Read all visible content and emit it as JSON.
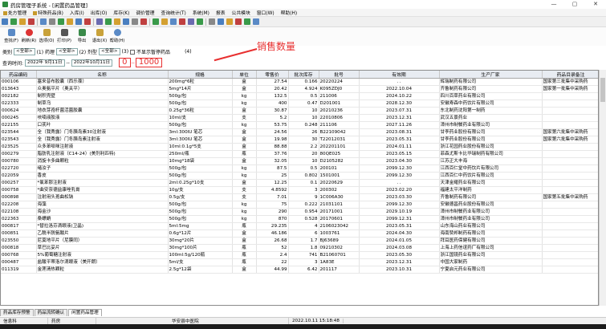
{
  "window": {
    "title": "药房管理子系统 - [闲置药品管理]",
    "controls": [
      "—",
      "▢",
      "✕"
    ]
  },
  "menubar": [
    "处方管理",
    "特殊药品(B)",
    "入库(I)",
    "出库(O)",
    "库存(K)",
    "调价管理",
    "查询统计(T)",
    "系统(M)",
    "报表",
    "公共模块",
    "窗口(W)",
    "帮助(H)"
  ],
  "actions": [
    {
      "label": "查找(F)",
      "color": "#5a8ac6"
    },
    {
      "label": "刷新(R)",
      "color": "#d33"
    },
    {
      "label": "选项(O)",
      "color": "#c9a23a"
    },
    {
      "label": "打印(P)",
      "color": "#555"
    },
    {
      "label": "导出",
      "color": "#3a8a4a"
    },
    {
      "label": "退出(X)",
      "color": "#c9a23a"
    },
    {
      "label": "帮助(H)",
      "color": "#5a8ac6"
    }
  ],
  "annotation": "销售数量",
  "filters": {
    "category_label": "类别",
    "category_value": "<全部>",
    "drug_prop_label": "(1) 药理",
    "drug_prop_value": "<全部>",
    "form_label": "(2) 剂型",
    "form_value": "<全部>",
    "form_suffix": "(3)",
    "show_disabled": "不显示暂停药品",
    "show_disabled_suffix": "(4)",
    "time_label": "查询时间:",
    "time_from": "2022年 9月11日",
    "time_sep": "--",
    "time_to": "2022年10月11日",
    "qty_from": "0",
    "qty_sep": "--",
    "qty_to": "1000"
  },
  "table": {
    "columns": [
      "药品编码",
      "名称",
      "规格",
      "单位",
      "零售价",
      "批次库存",
      "批号",
      "有效期",
      "生产厂家",
      "药品目录备注"
    ],
    "rows": [
      [
        "000106",
        "塞来昔布胶囊（西乐葆）",
        "200mg*6粒",
        "盒",
        "27.54",
        "0.166",
        "20220224",
        ". .",
        "辉瑞制药有限公司",
        "国家第三批集中采购药"
      ],
      [
        "013643",
        "众奥氨平片（奥关平）",
        "5mg*14片",
        "盒",
        "20.42",
        "4.924",
        "K095ZDJ0",
        "2022.10.04",
        "齐鲁制药有限公司",
        "国家第一批集中采购药"
      ],
      [
        "002182",
        "制积壳壁",
        "500g/包",
        "kg",
        "132.5",
        "0.5",
        "211006",
        "2024.10.22",
        "四川百草药业有限公司",
        ""
      ],
      [
        "022333",
        "制草乌",
        "500g/包",
        "kg",
        "400",
        "0.47",
        "D201001",
        "2028.12.30",
        "安徽寿森中药饮片有限公司",
        ""
      ],
      [
        "000624",
        "地衣芽孢杆菌活菌胶囊",
        "0.25g*36粒",
        "盒",
        "30.87",
        "10",
        "20210236",
        "2023.07.31",
        "东北制药沈阳第一制药",
        ""
      ],
      [
        "000245",
        "呋喃液胶液",
        "10ml/支",
        "支",
        "5.2",
        "10",
        "22010806",
        "2023.12.31",
        "武汉五景药业",
        ""
      ],
      [
        "022155",
        "口芪叶",
        "500g/包",
        "kg",
        "53.75",
        "0.248",
        "211106",
        "2027.11.26",
        "漳州市制餐药业有限公司",
        ""
      ],
      [
        "023544",
        "全（我秀露）门冬胰岛素30注射液",
        "3ml:300IU 笔芯",
        "盒",
        "24.56",
        "26",
        "B22109042",
        "2023.08.31",
        "甘李药业股份有限公司",
        "国家第六批集中采购药"
      ],
      [
        "023543",
        "全（我秀露）门冬胰岛素注射液",
        "3ml:300IU 笔芯",
        "盒",
        "19.98",
        "30",
        "T22012031",
        "2023.05.31",
        "甘李药业股份有限公司",
        "国家第六批集中采购药"
      ],
      [
        "023525",
        "众多苯哌咪注射液",
        "10ml:0.1g*5支",
        "盒",
        "88.88",
        "2.2",
        "202201101",
        "2024.01.11",
        "浙江花园药业股份有限公司",
        ""
      ],
      [
        "000279",
        "脂肪乳注射液（C14-24）(美剂利匹特)",
        "250ml/瓶",
        "瓶",
        "37.76",
        "20",
        "80QE025",
        "2023.05.15",
        "菲森尤斯卡比华瑞制药有限公司",
        ""
      ],
      [
        "000780",
        "消旋卡多曲颗粒",
        "10mg*18袋",
        "盒",
        "32.05",
        "10",
        "D2105282",
        "2023.04.30",
        "江苏正大丰海",
        ""
      ],
      [
        "022720",
        "绪汝子",
        "500g/包",
        "kg",
        "87.5",
        "0.5",
        "200101",
        "2099.12.30",
        "江西百仁堂中药饮片有限公司",
        ""
      ],
      [
        "022059",
        "香皮",
        "500g/包",
        "kg",
        "25",
        "0.802",
        "1501001",
        "2099.12.30",
        "江西百仁中药饮片有限公司",
        ""
      ],
      [
        "000257",
        "*氯苯那注射液",
        "2ml:0.25g*10支",
        "盒",
        "12.25",
        "0.1",
        "20220629",
        ". .",
        "天津金耀药业有限公司",
        ""
      ],
      [
        "000758",
        "*曲安奈德益康唑乳膏",
        "10g/支",
        "支",
        "4.8592",
        "3",
        "200302",
        "2023.02.20",
        "福建太平洋制药",
        ""
      ],
      [
        "000898",
        "注射用头孢曲松钠",
        "0.5g/支",
        "支",
        "7.01",
        "9",
        "1C006A30",
        "2023.03.30",
        "齐鲁制药有限公司",
        "国家第五批集中采购药"
      ],
      [
        "022208",
        "海藻",
        "500g/包",
        "kg",
        "75",
        "0.222",
        "21031101",
        "2099.12.30",
        "安徽德昌药业股份有限公司",
        ""
      ],
      [
        "022108",
        "海金沙",
        "500g/包",
        "kg",
        "290",
        "0.954",
        "20171001",
        "2029.10.19",
        "漳州市制餐药业有限公司",
        ""
      ],
      [
        "022363",
        "桑螵蛸",
        "500g/包",
        "kg",
        "870",
        "0.528",
        "20170601",
        "2099.12.31",
        "漳州市制餐药业有限公司",
        ""
      ],
      [
        "000817",
        "*替拉洛芬滴眼液(卫晶)",
        "5ml:5mg",
        "瓶",
        "29.235",
        "4",
        "2106023042",
        "2023.05.31",
        "山东海山药业有限公司",
        ""
      ],
      [
        "000851",
        "乙酰半胱氨酸片",
        "0.6g*12片",
        "盒",
        "46.186",
        "6",
        "1003761",
        "2024.04.30",
        "海南赞邦制药有限公司",
        ""
      ],
      [
        "023550",
        "尼莫地平片（尼膜同）",
        "30mg*20片",
        "盒",
        "26.68",
        "1.7",
        "BJ63689",
        "2024.01.05",
        "拜耳医药保健有限公司",
        ""
      ],
      [
        "000818",
        "草巴比妥片",
        "30mg*100片",
        "瓶",
        "52",
        "1.8",
        "09210302",
        "2024.03.08",
        "上海上药信谊药厂有限公司",
        ""
      ],
      [
        "000768",
        "5%葡萄糖注射液",
        "100ml:5g/120瓶",
        "瓶",
        "2.4",
        "741",
        "B21060701",
        "2023.05.30",
        "浙江国镜药业有限公司",
        ""
      ],
      [
        "000487",
        "盐酸平蒂洛尔滴眼液（美开朗）",
        "5ml/支",
        "瓶",
        "22",
        "3",
        "1A83E",
        "2023.12.31",
        "中国大家制药",
        ""
      ],
      [
        "011319",
        "金莲清热颗粒",
        "2.5g*12袋",
        "盒",
        "44.99",
        "6.42",
        "201117",
        "2023.10.31",
        "宁夏启元药业有限公司",
        ""
      ]
    ]
  },
  "tabs": [
    "药品库存预警",
    "药品流转确认",
    "闲置药品管理"
  ],
  "status": [
    "信息科",
    "药房",
    "",
    "华安县中医院",
    "2022.10.11 15:18:48"
  ]
}
